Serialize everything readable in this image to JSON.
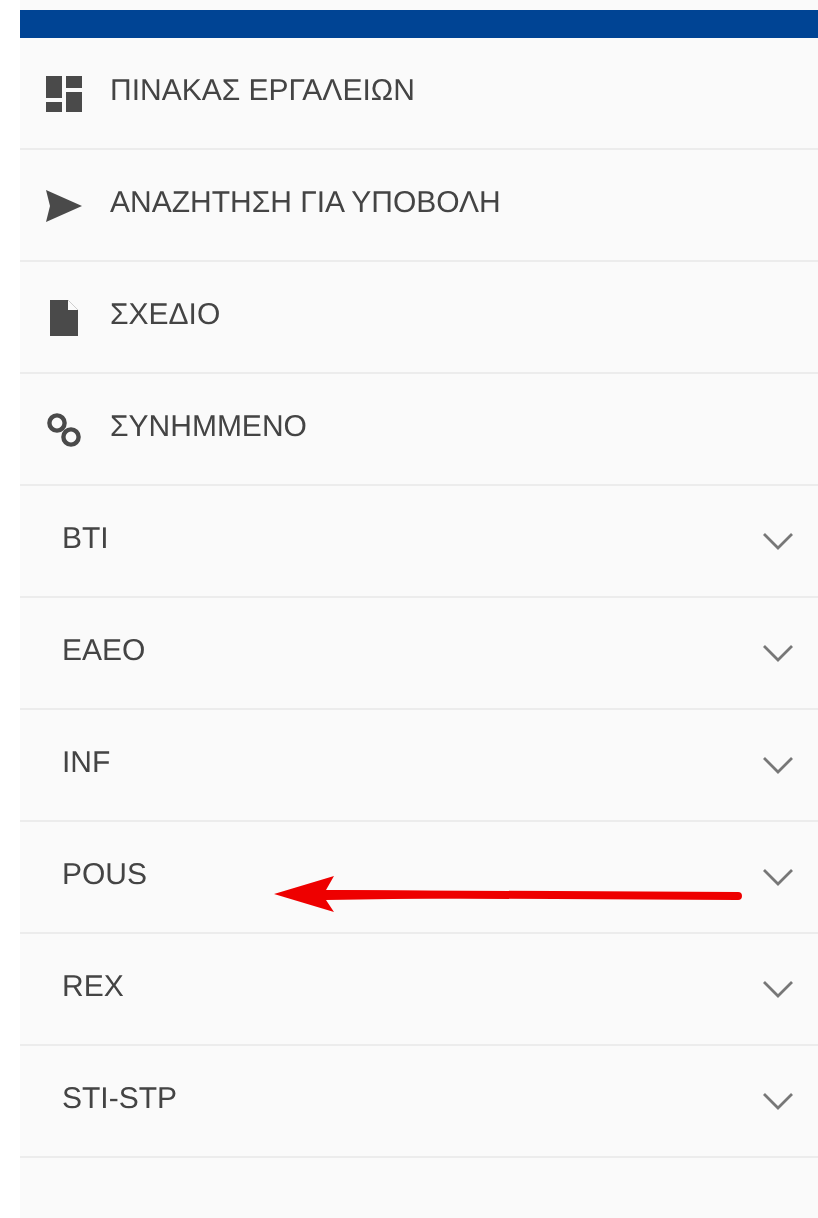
{
  "nav_items": [
    {
      "kind": "link",
      "label": "ΠΙΝΑΚΑΣ ΕΡΓΑΛΕΙΩΝ"
    },
    {
      "kind": "link",
      "label": "ΑΝΑΖΗΤΗΣΗ ΓΙΑ ΥΠΟΒΟΛΗ"
    },
    {
      "kind": "link",
      "label": "ΣΧΕΔΙΟ"
    },
    {
      "kind": "link",
      "label": "ΣΥΝΗΜΜΕΝΟ"
    },
    {
      "kind": "group",
      "label": "BTI",
      "expanded": false,
      "pointed": false
    },
    {
      "kind": "group",
      "label": "EAEO",
      "expanded": false,
      "pointed": false
    },
    {
      "kind": "group",
      "label": "INF",
      "expanded": false,
      "pointed": false
    },
    {
      "kind": "group",
      "label": "POUS",
      "expanded": false,
      "pointed": true
    },
    {
      "kind": "group",
      "label": "REX",
      "expanded": false,
      "pointed": false
    },
    {
      "kind": "group",
      "label": "STI-STP",
      "expanded": false,
      "pointed": false
    }
  ]
}
